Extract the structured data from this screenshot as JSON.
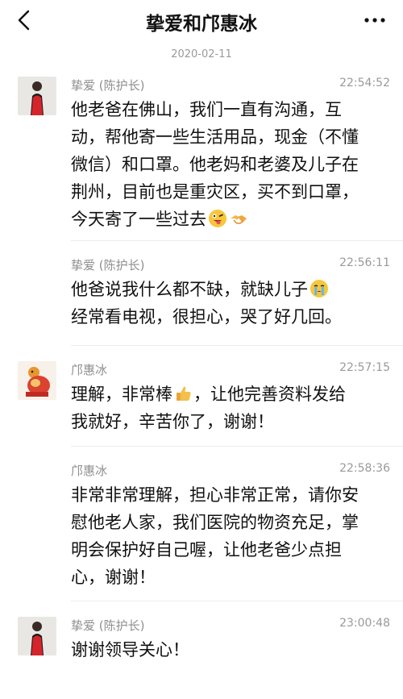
{
  "header": {
    "title": "挚爱和邝惠冰"
  },
  "date_separator": "2020-02-11",
  "messages": [
    {
      "sender": "挚爱 (陈护长)",
      "time": "22:54:52",
      "lines": [
        "他老爸在佛山，我们一直有沟通，互",
        "动，帮他寄一些生活用品，现金（不懂",
        "微信）和口罩。他老妈和老婆及儿子在",
        "荆州，目前也是重灾区，买不到口罩，",
        "今天寄了一些过去"
      ],
      "emojis": [
        "grinning-tongue-emoji",
        "handshake-emoji"
      ]
    },
    {
      "sender": "挚爱 (陈护长)",
      "time": "22:56:11",
      "lines": [
        "他爸说我什么都不缺，就缺儿子",
        "经常看电视，很担心，哭了好几回。"
      ],
      "emojis": [
        "crying-emoji"
      ]
    },
    {
      "sender": "邝惠冰",
      "time": "22:57:15",
      "line1_before": "理解，非常棒",
      "line1_after": "，让他完善资料发给",
      "line2": "我就好，辛苦你了，谢谢！",
      "emojis": [
        "thumbs-up-emoji"
      ]
    },
    {
      "sender": "邝惠冰",
      "time": "22:58:36",
      "lines": [
        "非常非常理解，担心非常正常，请你安",
        "慰他老人家，我们医院的物资充足，掌",
        "明会保护好自己喔，让他老爸少点担",
        "心，谢谢！"
      ]
    },
    {
      "sender": "挚爱 (陈护长)",
      "time": "23:00:48",
      "lines": [
        "谢谢领导关心！"
      ]
    }
  ],
  "colors": {
    "text": "#111111",
    "secondary": "#8f8f8f",
    "divider": "#ececec"
  }
}
